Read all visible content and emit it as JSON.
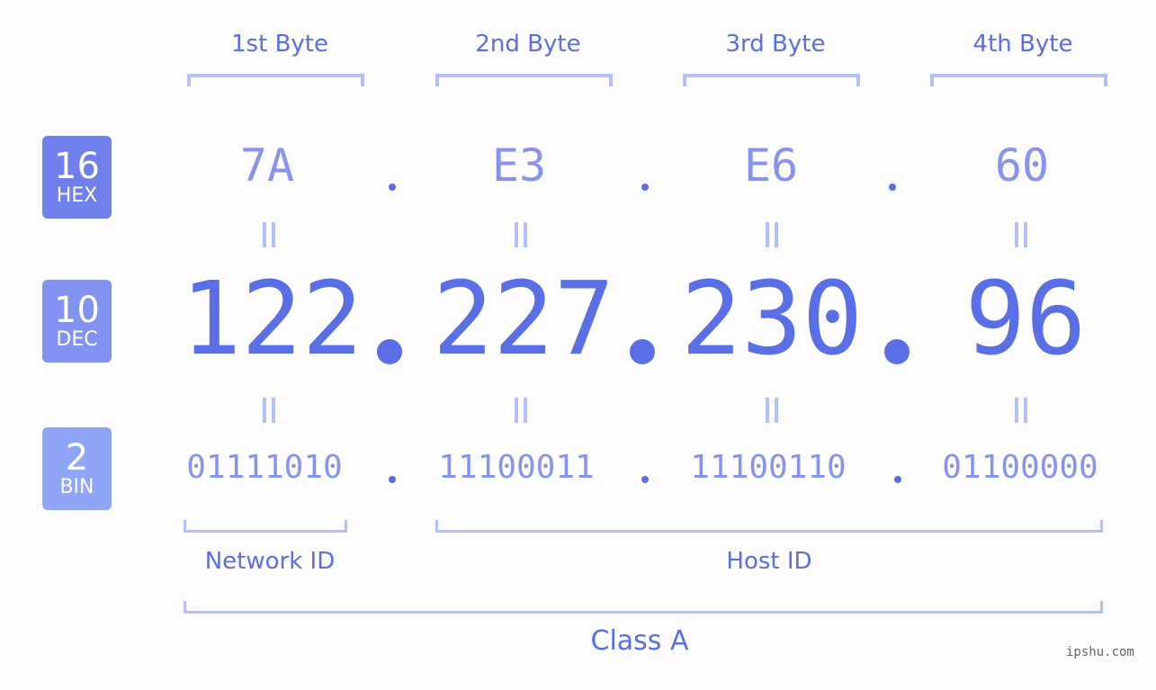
{
  "bytes": [
    {
      "label": "1st Byte",
      "hex": "7A",
      "dec": "122",
      "bin": "01111010"
    },
    {
      "label": "2nd Byte",
      "hex": "E3",
      "dec": "227",
      "bin": "11100011"
    },
    {
      "label": "3rd Byte",
      "hex": "E6",
      "dec": "230",
      "bin": "11100110"
    },
    {
      "label": "4th Byte",
      "hex": "60",
      "dec": "96",
      "bin": "01100000"
    }
  ],
  "badges": {
    "hex": {
      "num": "16",
      "unit": "HEX",
      "color": "#6f80ec"
    },
    "dec": {
      "num": "10",
      "unit": "DEC",
      "color": "#8292f0"
    },
    "bin": {
      "num": "2",
      "unit": "BIN",
      "color": "#8fa6f6"
    }
  },
  "segments": {
    "network": "Network ID",
    "host": "Host ID",
    "class": "Class A"
  },
  "colors": {
    "accent": "#5a6ee6",
    "light": "#8794ee",
    "bracket": "#b3bff7"
  },
  "watermark": "ipshu.com"
}
